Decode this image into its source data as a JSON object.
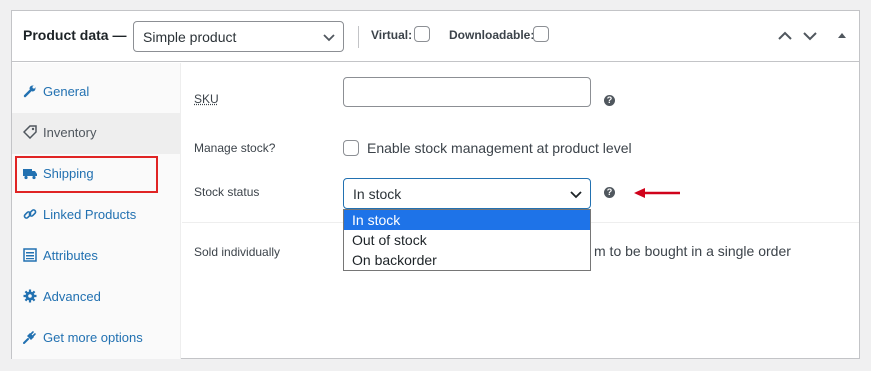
{
  "header": {
    "title": "Product data —",
    "product_type": "Simple product",
    "virtual_label": "Virtual:",
    "downloadable_label": "Downloadable:"
  },
  "sidebar": {
    "items": [
      {
        "label": "General",
        "icon": "wrench-icon"
      },
      {
        "label": "Inventory",
        "icon": "tag-icon"
      },
      {
        "label": "Shipping",
        "icon": "truck-icon"
      },
      {
        "label": "Linked Products",
        "icon": "link-icon"
      },
      {
        "label": "Attributes",
        "icon": "list-icon"
      },
      {
        "label": "Advanced",
        "icon": "gear-icon"
      },
      {
        "label": "Get more options",
        "icon": "plugin-icon"
      }
    ],
    "active_index": 1
  },
  "inventory": {
    "sku_label": "SKU",
    "sku_value": "",
    "manage_stock_label": "Manage stock?",
    "manage_stock_text": "Enable stock management at product level",
    "stock_status_label": "Stock status",
    "stock_status_value": "In stock",
    "stock_status_options": [
      "In stock",
      "Out of stock",
      "On backorder"
    ],
    "sold_individually_label": "Sold individually",
    "sold_individually_text": "m to be bought in a single order"
  },
  "colors": {
    "link": "#2271b1",
    "highlight_box": "#e02424",
    "selected_option": "#1e73e8",
    "arrow": "#d0021b"
  }
}
